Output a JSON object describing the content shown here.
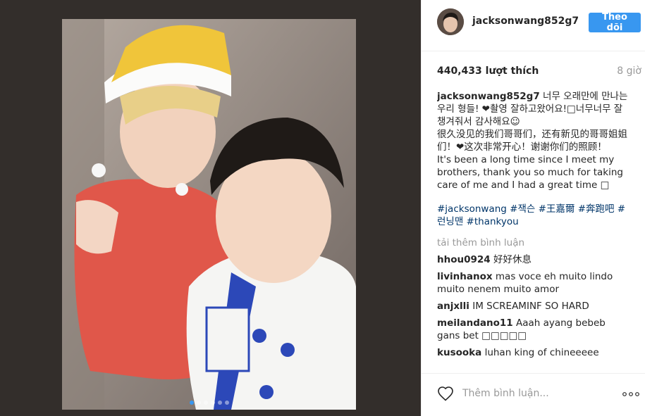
{
  "post": {
    "username": "jacksonwang852g7",
    "follow_label": "Theo dõi",
    "likes": "440,433 lượt thích",
    "time": "8 giờ",
    "caption": {
      "user": "jacksonwang852g7",
      "line1": "너무 오래만에 만나는 우리 형들! ❤촬영 잘하고왔어요!□너무너무 잘챙겨줘서 감사해요☺",
      "line2": "很久没见的我们哥哥们，还有新见的哥哥姐姐们！❤这次非常开心！谢谢你们的照顾！",
      "line3": "It's been a long time since I meet my brothers, thank you so much for taking care of me and I had a great time □"
    },
    "hashtags": "#jacksonwang #잭슨 #王嘉爾 #奔跑吧 #런닝맨 #thankyou",
    "load_more": "tải thêm bình luận",
    "comments": [
      {
        "user": "hhou0924",
        "text": "好好休息"
      },
      {
        "user": "livinhanox",
        "text": "mas voce eh muito lindo muito nenem muito amor"
      },
      {
        "user": "anjxlli",
        "text": "IM SCREAMINF SO HARD"
      },
      {
        "user": "meilandano11",
        "text": "Aaah ayang bebeb gans bet □□□□□"
      },
      {
        "user": "kusooka",
        "text": "luhan king of chineeeee"
      }
    ],
    "comment_placeholder": "Thêm bình luận...",
    "carousel": {
      "count": 6,
      "active": 0
    }
  },
  "icons": {
    "like": "heart-outline-icon",
    "more": "more-options-icon"
  },
  "colors": {
    "accent": "#3897f0",
    "left_bg": "#332e2b",
    "hashtag": "#003569",
    "muted": "#999999"
  }
}
